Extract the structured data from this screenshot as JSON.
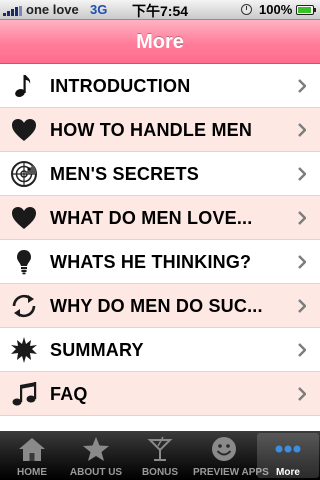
{
  "status_bar": {
    "carrier": "one love",
    "network": "3G",
    "time": "下午7:54",
    "battery_percent": "100%"
  },
  "nav": {
    "title": "More"
  },
  "menu": {
    "items": [
      {
        "label": "INTRODUCTION",
        "icon": "music-note-icon"
      },
      {
        "label": "HOW TO HANDLE MEN",
        "icon": "heart-icon"
      },
      {
        "label": "MEN'S SECRETS",
        "icon": "radar-icon"
      },
      {
        "label": "WHAT DO MEN LOVE...",
        "icon": "heart-icon"
      },
      {
        "label": "WHATS HE THINKING?",
        "icon": "lightbulb-icon"
      },
      {
        "label": "WHY DO MEN DO SUC...",
        "icon": "refresh-icon"
      },
      {
        "label": "SUMMARY",
        "icon": "sun-icon"
      },
      {
        "label": "FAQ",
        "icon": "music-notes-icon"
      }
    ]
  },
  "tabbar": {
    "tabs": [
      {
        "label": "HOME",
        "icon": "house-icon",
        "selected": false
      },
      {
        "label": "ABOUT US",
        "icon": "star-icon",
        "selected": false
      },
      {
        "label": "BONUS",
        "icon": "cocktail-icon",
        "selected": false
      },
      {
        "label": "PREVIEW APPS",
        "icon": "smiley-icon",
        "selected": false
      },
      {
        "label": "More",
        "icon": "more-dots-icon",
        "selected": true
      }
    ]
  },
  "colors": {
    "nav_pink": "#ff7d9a",
    "row_alt": "#fde8e3",
    "tab_dots_blue": "#3d8de0"
  }
}
